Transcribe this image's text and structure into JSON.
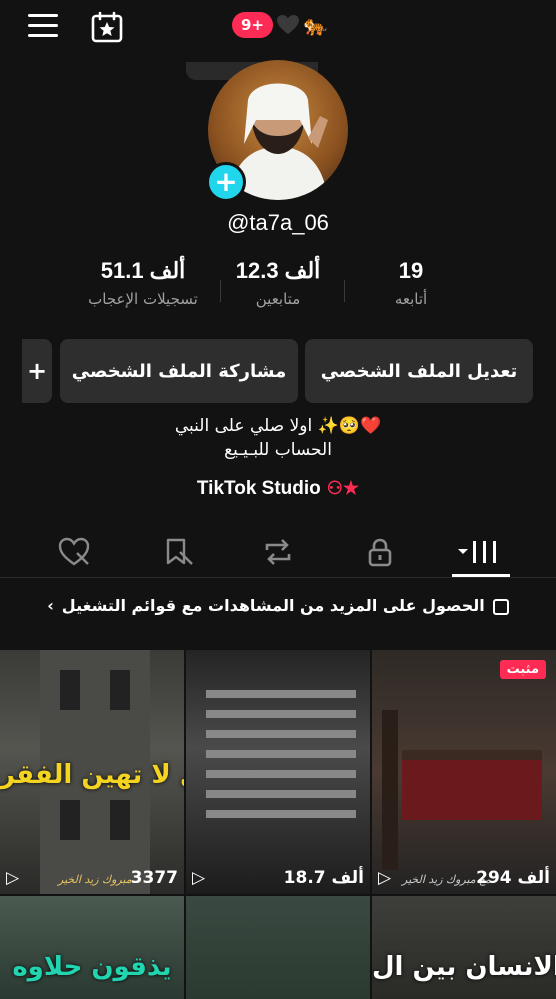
{
  "header": {
    "notification_count": "9+",
    "tiger_emoji": "🐅"
  },
  "profile": {
    "username": "@ta7a_06",
    "stats": [
      {
        "value": "51.1 ألف",
        "label": "تسجيلات الإعجاب"
      },
      {
        "value": "12.3 ألف",
        "label": "متابعين"
      },
      {
        "value": "19",
        "label": "أتابعه"
      }
    ],
    "bio_line1": "اولا صلي على النبي ✨🥺❤️",
    "bio_line2": "الحساب للبـيـيع",
    "studio_label": "TikTok Studio"
  },
  "buttons": {
    "edit_profile": "تعديل الملف الشخصي",
    "share_profile": "مشاركة الملف الشخصي",
    "add_friend": "+"
  },
  "playlist_prompt": "الحصول على المزيد من المشاهدات مع قوائم التشغيل",
  "videos": [
    {
      "overlay": "قل لا تهين الفقر",
      "signature": "مبروك زيد الخير",
      "views": "3377"
    },
    {
      "overlay": "",
      "signature": "",
      "views": "18.7 ألف"
    },
    {
      "overlay": "",
      "signature": "مع مبروك زيد الخير",
      "views": "294 ألف",
      "pinned": "مثبت"
    },
    {
      "overlay": "يذقون حلاوه",
      "signature": "",
      "views": ""
    },
    {
      "overlay": "",
      "signature": "",
      "views": ""
    },
    {
      "overlay": "الانسان بين ال",
      "signature": "",
      "views": ""
    }
  ]
}
